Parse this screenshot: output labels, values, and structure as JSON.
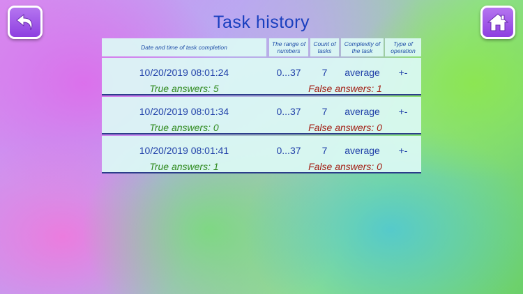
{
  "header": {
    "title": "Task history"
  },
  "buttons": {
    "back_icon": "back-arrow-icon",
    "home_icon": "home-icon"
  },
  "columns": {
    "date": "Date and time of task completion",
    "range": "The range of numbers",
    "count": "Count of tasks",
    "complexity": "Complexity of the task",
    "operation": "Type of operation"
  },
  "rows": [
    {
      "datetime": "10/20/2019 08:01:24",
      "range": "0...37",
      "count": "7",
      "complexity": "average",
      "operation": "+-",
      "true_answers": "True answers: 5",
      "false_answers": "False answers: 1"
    },
    {
      "datetime": "10/20/2019 08:01:34",
      "range": "0...37",
      "count": "7",
      "complexity": "average",
      "operation": "+-",
      "true_answers": "True answers: 0",
      "false_answers": "False answers: 0"
    },
    {
      "datetime": "10/20/2019 08:01:41",
      "range": "0...37",
      "count": "7",
      "complexity": "average",
      "operation": "+-",
      "true_answers": "True answers: 1",
      "false_answers": "False answers: 0"
    }
  ],
  "colors": {
    "title": "#1a3fbf",
    "button": "#9a4ee6",
    "true": "#2f8a1e",
    "false": "#a21e14"
  }
}
